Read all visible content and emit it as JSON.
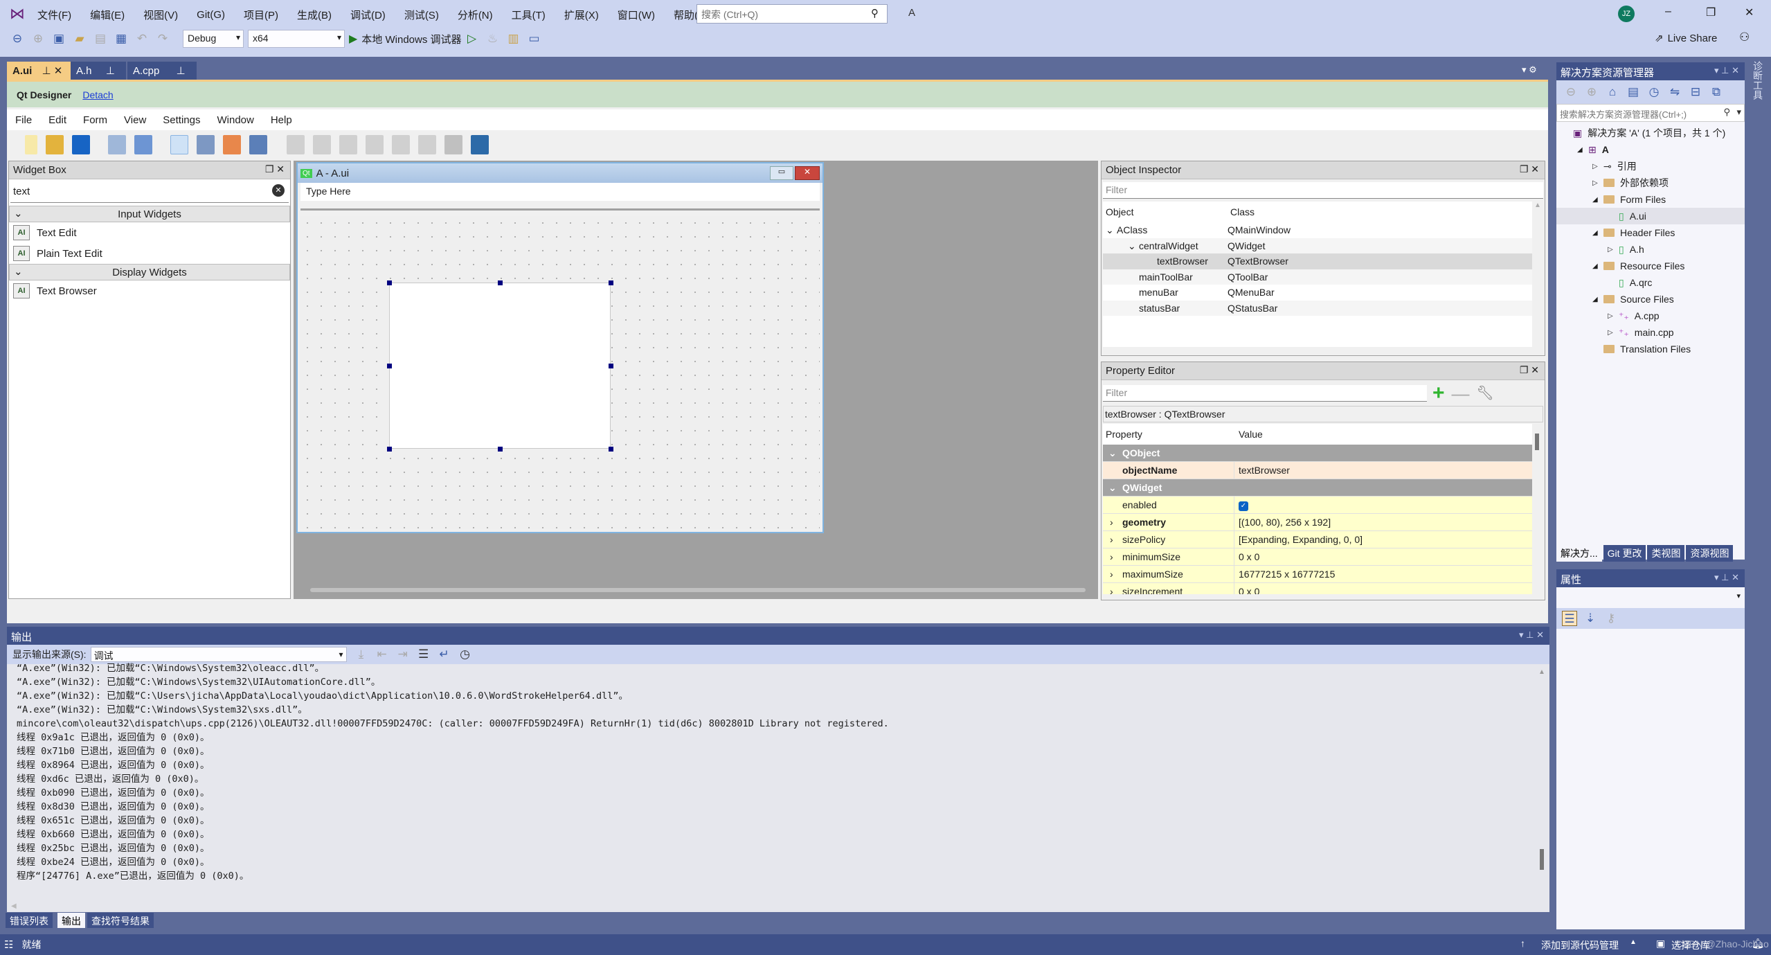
{
  "titlebar": {
    "menu": [
      "文件(F)",
      "编辑(E)",
      "视图(V)",
      "Git(G)",
      "项目(P)",
      "生成(B)",
      "调试(D)",
      "测试(S)",
      "分析(N)",
      "工具(T)",
      "扩展(X)",
      "窗口(W)",
      "帮助(H)"
    ],
    "search_placeholder": "搜索 (Ctrl+Q)",
    "solution_name": "A",
    "avatar": "JZ",
    "live_share": "Live Share",
    "config": "Debug",
    "platform": "x64",
    "run_label": "本地 Windows 调试器"
  },
  "doc_tabs": [
    {
      "label": "A.ui",
      "active": true
    },
    {
      "label": "A.h"
    },
    {
      "label": "A.cpp"
    }
  ],
  "qt": {
    "title": "Qt Designer",
    "detach": "Detach",
    "menu": [
      "File",
      "Edit",
      "Form",
      "View",
      "Settings",
      "Window",
      "Help"
    ],
    "widget_box": {
      "title": "Widget Box",
      "filter": "text",
      "categories": [
        {
          "label": "Input Widgets",
          "items": [
            "Text Edit",
            "Plain Text Edit"
          ]
        },
        {
          "label": "Display Widgets",
          "items": [
            "Text Browser"
          ]
        }
      ]
    },
    "form": {
      "title": "A - A.ui",
      "type_here": "Type Here"
    },
    "object_inspector": {
      "title": "Object Inspector",
      "filter_placeholder": "Filter",
      "columns": [
        "Object",
        "Class"
      ],
      "rows": [
        {
          "object": "AClass",
          "class": "QMainWindow"
        },
        {
          "object": "centralWidget",
          "class": "QWidget"
        },
        {
          "object": "textBrowser",
          "class": "QTextBrowser"
        },
        {
          "object": "mainToolBar",
          "class": "QToolBar"
        },
        {
          "object": "menuBar",
          "class": "QMenuBar"
        },
        {
          "object": "statusBar",
          "class": "QStatusBar"
        }
      ]
    },
    "property_editor": {
      "title": "Property Editor",
      "filter_placeholder": "Filter",
      "context": "textBrowser : QTextBrowser",
      "columns": [
        "Property",
        "Value"
      ],
      "groups": {
        "qobject": "QObject",
        "qwidget": "QWidget"
      },
      "rows": [
        {
          "property": "objectName",
          "value": "textBrowser"
        },
        {
          "property": "enabled",
          "value": "",
          "checked": true
        },
        {
          "property": "geometry",
          "value": "[(100, 80), 256 x 192]"
        },
        {
          "property": "sizePolicy",
          "value": "[Expanding, Expanding, 0, 0]"
        },
        {
          "property": "minimumSize",
          "value": "0 x 0"
        },
        {
          "property": "maximumSize",
          "value": "16777215 x 16777215"
        },
        {
          "property": "sizeIncrement",
          "value": "0 x 0"
        }
      ]
    }
  },
  "solution_explorer": {
    "title": "解决方案资源管理器",
    "search_placeholder": "搜索解决方案资源管理器(Ctrl+;)",
    "items": [
      "解决方案 'A' (1 个项目，共 1 个)",
      "A",
      "引用",
      "外部依赖项",
      "Form Files",
      "A.ui",
      "Header Files",
      "A.h",
      "Resource Files",
      "A.qrc",
      "Source Files",
      "A.cpp",
      "main.cpp",
      "Translation Files"
    ],
    "tabs": [
      "解决方...",
      "Git 更改",
      "类视图",
      "资源视图"
    ],
    "side_tab": "诊断工具"
  },
  "properties_panel": {
    "title": "属性"
  },
  "output": {
    "title": "输出",
    "source_label": "显示输出来源(S):",
    "source_value": "调试",
    "lines": [
      "“A.exe”(Win32): 已加载“C:\\Windows\\System32\\oleacc.dll”。",
      "“A.exe”(Win32): 已加载“C:\\Windows\\System32\\UIAutomationCore.dll”。",
      "“A.exe”(Win32): 已加载“C:\\Users\\jicha\\AppData\\Local\\youdao\\dict\\Application\\10.0.6.0\\WordStrokeHelper64.dll”。",
      "“A.exe”(Win32): 已加载“C:\\Windows\\System32\\sxs.dll”。",
      "mincore\\com\\oleaut32\\dispatch\\ups.cpp(2126)\\OLEAUT32.dll!00007FFD59D2470C: (caller: 00007FFD59D249FA) ReturnHr(1) tid(d6c) 8002801D Library not registered.",
      "线程 0x9a1c 已退出，返回值为 0 (0x0)。",
      "线程 0x71b0 已退出，返回值为 0 (0x0)。",
      "线程 0x8964 已退出，返回值为 0 (0x0)。",
      "线程 0xd6c 已退出，返回值为 0 (0x0)。",
      "线程 0xb090 已退出，返回值为 0 (0x0)。",
      "线程 0x8d30 已退出，返回值为 0 (0x0)。",
      "线程 0x651c 已退出，返回值为 0 (0x0)。",
      "线程 0xb660 已退出，返回值为 0 (0x0)。",
      "线程 0x25bc 已退出，返回值为 0 (0x0)。",
      "线程 0xbe24 已退出，返回值为 0 (0x0)。",
      "程序“[24776] A.exe”已退出，返回值为 0 (0x0)。"
    ]
  },
  "bottom_tabs": [
    "错误列表",
    "输出",
    "查找符号结果"
  ],
  "status": {
    "ready": "就绪",
    "source_control": "添加到源代码管理",
    "repo": "选择仓库"
  },
  "watermark": "CSDN @Zhao-Jichao",
  "colors": {
    "accent": "#3f5189",
    "band": "#5d6b99",
    "menu_bg": "#ccd5f0",
    "qt_green": "#cadfc9",
    "tab_active": "#f5cc84"
  }
}
